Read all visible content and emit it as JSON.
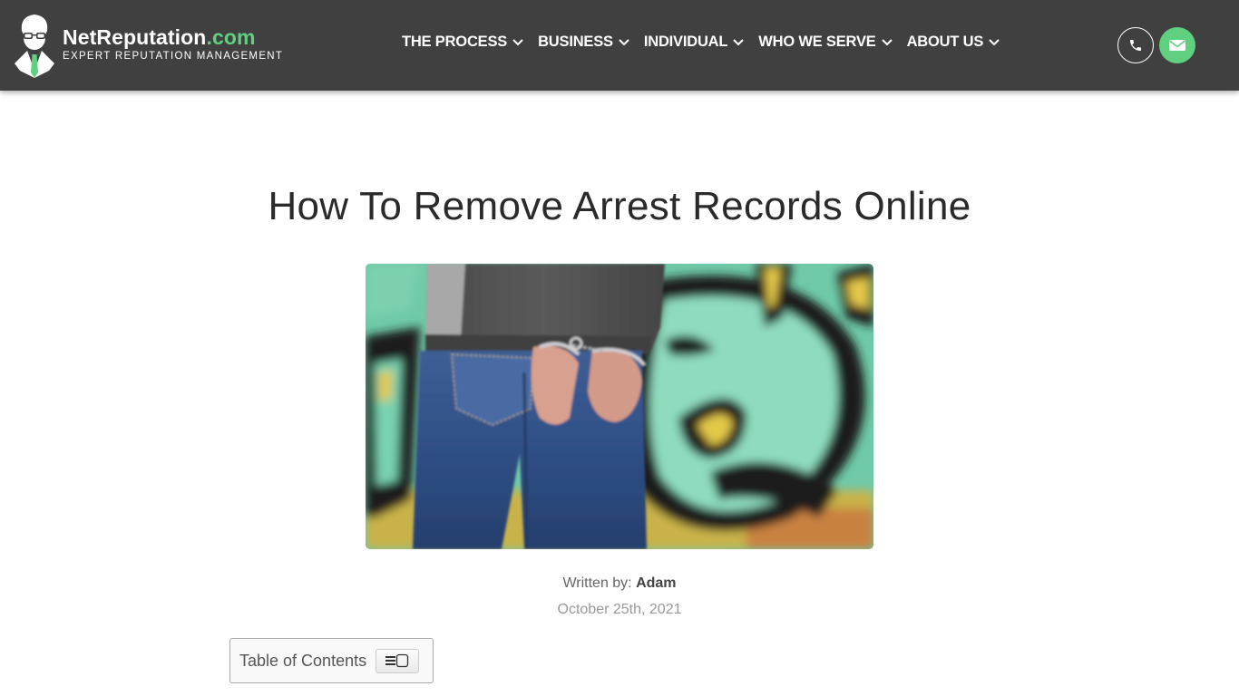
{
  "header": {
    "logo": {
      "name": "NetReputation",
      "tld": ".com",
      "tagline": "EXPERT REPUTATION MANAGEMENT",
      "icon": "mascot-logo-icon"
    },
    "nav": [
      {
        "label": "THE PROCESS",
        "icon": "chevron-down-icon"
      },
      {
        "label": "BUSINESS",
        "icon": "chevron-down-icon"
      },
      {
        "label": "INDIVIDUAL",
        "icon": "chevron-down-icon"
      },
      {
        "label": "WHO WE SERVE",
        "icon": "chevron-down-icon"
      },
      {
        "label": "ABOUT US",
        "icon": "chevron-down-icon"
      }
    ],
    "contact": {
      "phone_icon": "phone-icon",
      "mail_icon": "envelope-icon"
    }
  },
  "colors": {
    "header_bg": "#404040",
    "accent_green": "#5fcf80",
    "title_text": "#2a2a2a"
  },
  "article": {
    "title": "How To Remove Arrest Records Online",
    "hero_alt": "Person in jeans with handcuffed hands behind back in front of graffiti wall",
    "byline_prefix": "Written by: ",
    "author": "Adam",
    "date": "October 25th, 2021"
  },
  "toc": {
    "label": "Table of Contents",
    "toggle_icon": "list-toggle-icon"
  }
}
